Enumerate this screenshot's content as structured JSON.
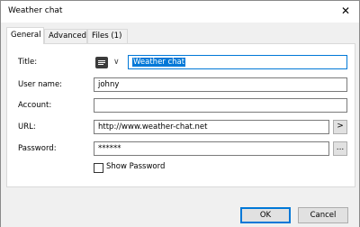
{
  "window": {
    "title": "Weather chat"
  },
  "tabs": [
    {
      "label": "General",
      "active": true
    },
    {
      "label": "Advanced",
      "active": false
    },
    {
      "label": "Files (1)",
      "active": false
    }
  ],
  "form": {
    "title_label": "Title:",
    "title_value": "Weather chat",
    "username_label": "User name:",
    "username_value": "johny",
    "account_label": "Account:",
    "account_value": "",
    "url_label": "URL:",
    "url_value": "http://www.weather-chat.net",
    "url_button": ">",
    "password_label": "Password:",
    "password_value": "******",
    "password_button": "...",
    "show_password_label": "Show Password",
    "show_password_checked": false
  },
  "buttons": {
    "ok": "OK",
    "cancel": "Cancel"
  }
}
